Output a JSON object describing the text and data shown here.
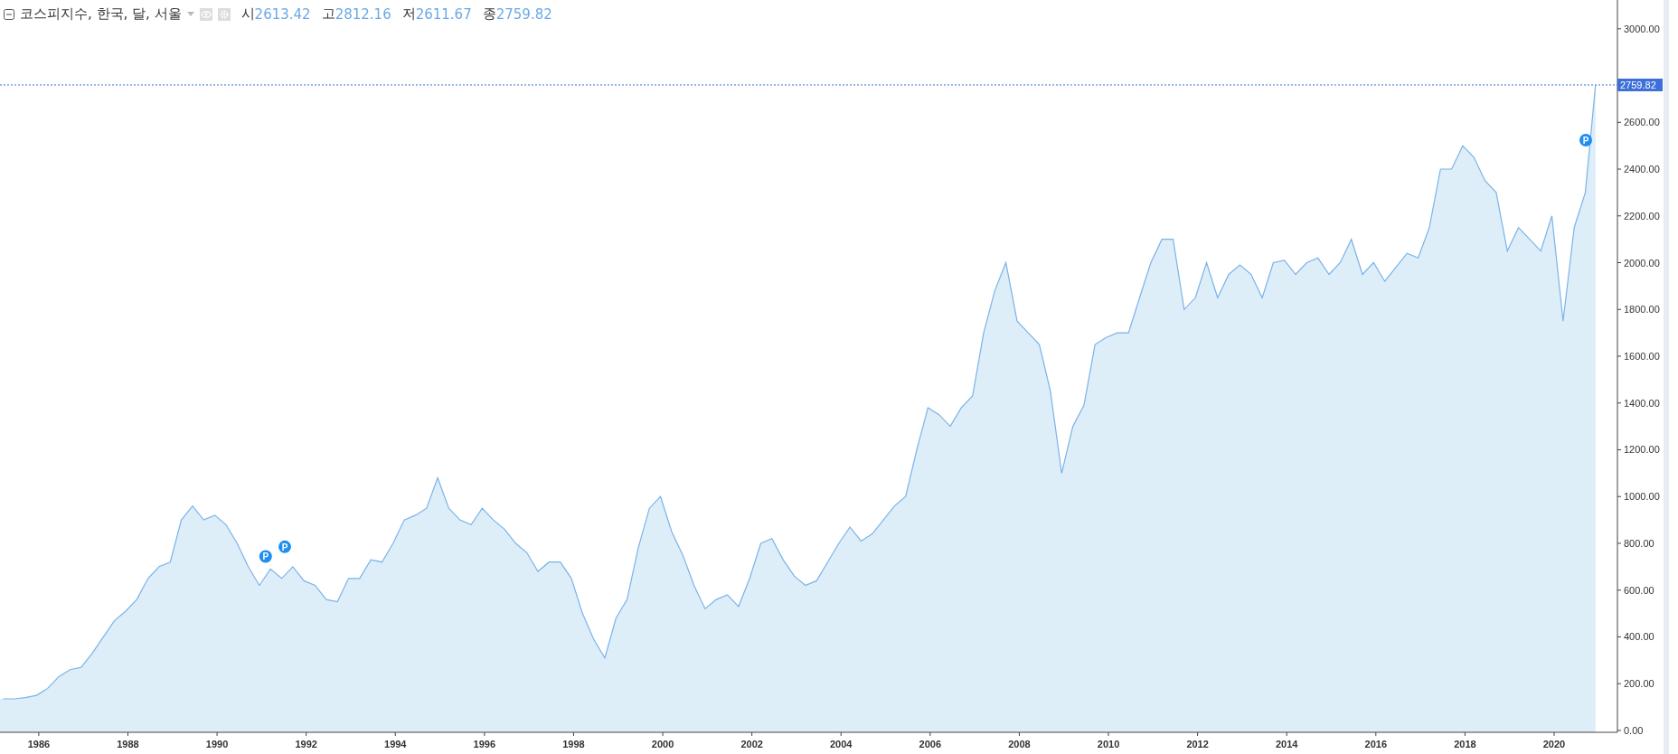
{
  "header": {
    "title": "코스피지수, 한국, 달, 서울",
    "stats": [
      {
        "label": "시",
        "value": "2613.42"
      },
      {
        "label": "고",
        "value": "2812.16"
      },
      {
        "label": "저",
        "value": "2611.67"
      },
      {
        "label": "종",
        "value": "2759.82"
      }
    ]
  },
  "chart_data": {
    "type": "area",
    "xlim": [
      1985.13,
      2021.42
    ],
    "ylim": [
      -8,
      3123
    ],
    "xticks": [
      {
        "value": 1986,
        "label": "1986"
      },
      {
        "value": 1988,
        "label": "1988"
      },
      {
        "value": 1990,
        "label": "1990"
      },
      {
        "value": 1992,
        "label": "1992"
      },
      {
        "value": 1994,
        "label": "1994"
      },
      {
        "value": 1996,
        "label": "1996"
      },
      {
        "value": 1998,
        "label": "1998"
      },
      {
        "value": 2000,
        "label": "2000"
      },
      {
        "value": 2002,
        "label": "2002"
      },
      {
        "value": 2004,
        "label": "2004"
      },
      {
        "value": 2006,
        "label": "2006"
      },
      {
        "value": 2008,
        "label": "2008"
      },
      {
        "value": 2010,
        "label": "2010"
      },
      {
        "value": 2012,
        "label": "2012"
      },
      {
        "value": 2014,
        "label": "2014"
      },
      {
        "value": 2016,
        "label": "2016"
      },
      {
        "value": 2018,
        "label": "2018"
      },
      {
        "value": 2020,
        "label": "2020"
      }
    ],
    "yticks": [
      {
        "value": 0,
        "label": "0.00"
      },
      {
        "value": 200,
        "label": "200.00"
      },
      {
        "value": 400,
        "label": "400.00"
      },
      {
        "value": 600,
        "label": "600.00"
      },
      {
        "value": 800,
        "label": "800.00"
      },
      {
        "value": 1000,
        "label": "1000.00"
      },
      {
        "value": 1200,
        "label": "1200.00"
      },
      {
        "value": 1400,
        "label": "1400.00"
      },
      {
        "value": 1600,
        "label": "1600.00"
      },
      {
        "value": 1800,
        "label": "1800.00"
      },
      {
        "value": 2000,
        "label": "2000.00"
      },
      {
        "value": 2200,
        "label": "2200.00"
      },
      {
        "value": 2400,
        "label": "2400.00"
      },
      {
        "value": 2600,
        "label": "2600.00"
      },
      {
        "value": 3000,
        "label": "3000.00"
      }
    ],
    "x": [
      1985.2,
      1985.45,
      1985.7,
      1985.95,
      1986.2,
      1986.45,
      1986.7,
      1986.95,
      1987.2,
      1987.45,
      1987.7,
      1987.95,
      1988.2,
      1988.45,
      1988.7,
      1988.95,
      1989.2,
      1989.45,
      1989.7,
      1989.95,
      1990.2,
      1990.45,
      1990.7,
      1990.95,
      1991.2,
      1991.45,
      1991.7,
      1991.95,
      1992.2,
      1992.45,
      1992.7,
      1992.95,
      1993.2,
      1993.45,
      1993.7,
      1993.95,
      1994.2,
      1994.45,
      1994.7,
      1994.95,
      1995.2,
      1995.45,
      1995.7,
      1995.95,
      1996.2,
      1996.45,
      1996.7,
      1996.95,
      1997.2,
      1997.45,
      1997.7,
      1997.95,
      1998.2,
      1998.45,
      1998.7,
      1998.95,
      1999.2,
      1999.45,
      1999.7,
      1999.95,
      2000.2,
      2000.45,
      2000.7,
      2000.95,
      2001.2,
      2001.45,
      2001.7,
      2001.95,
      2002.2,
      2002.45,
      2002.7,
      2002.95,
      2003.2,
      2003.45,
      2003.7,
      2003.95,
      2004.2,
      2004.45,
      2004.7,
      2004.95,
      2005.2,
      2005.45,
      2005.7,
      2005.95,
      2006.2,
      2006.45,
      2006.7,
      2006.95,
      2007.2,
      2007.45,
      2007.7,
      2007.95,
      2008.2,
      2008.45,
      2008.7,
      2008.95,
      2009.2,
      2009.45,
      2009.7,
      2009.95,
      2010.2,
      2010.45,
      2010.7,
      2010.95,
      2011.2,
      2011.45,
      2011.7,
      2011.95,
      2012.2,
      2012.45,
      2012.7,
      2012.95,
      2013.2,
      2013.45,
      2013.7,
      2013.95,
      2014.2,
      2014.45,
      2014.7,
      2014.95,
      2015.2,
      2015.45,
      2015.7,
      2015.95,
      2016.2,
      2016.45,
      2016.7,
      2016.95,
      2017.2,
      2017.45,
      2017.7,
      2017.95,
      2018.2,
      2018.45,
      2018.7,
      2018.95,
      2019.2,
      2019.45,
      2019.7,
      2019.95,
      2020.2,
      2020.45,
      2020.7,
      2020.93
    ],
    "ref_lines": [
      {
        "axis": "y",
        "value": 2759.82,
        "label": "2759.82"
      }
    ],
    "series": [
      {
        "color": "#7ab3e8",
        "values": [
          135,
          135,
          140,
          150,
          180,
          230,
          260,
          270,
          330,
          400,
          470,
          510,
          560,
          650,
          700,
          720,
          900,
          960,
          900,
          920,
          880,
          800,
          700,
          620,
          690,
          650,
          700,
          640,
          620,
          560,
          550,
          650,
          650,
          730,
          720,
          800,
          900,
          920,
          950,
          1080,
          950,
          900,
          880,
          950,
          900,
          860,
          800,
          760,
          680,
          720,
          720,
          650,
          500,
          390,
          310,
          480,
          560,
          780,
          950,
          1000,
          850,
          750,
          620,
          520,
          560,
          580,
          530,
          650,
          800,
          820,
          730,
          660,
          620,
          640,
          720,
          800,
          870,
          810,
          840,
          900,
          960,
          1000,
          1200,
          1380,
          1350,
          1300,
          1380,
          1430,
          1700,
          1880,
          2000,
          1750,
          1700,
          1650,
          1450,
          1100,
          1300,
          1390,
          1650,
          1680,
          1700,
          1700,
          1850,
          2000,
          2100,
          2100,
          1800,
          1850,
          2000,
          1850,
          1950,
          1990,
          1950,
          1850,
          2000,
          2010,
          1950,
          2000,
          2020,
          1950,
          2000,
          2100,
          1950,
          2000,
          1920,
          1980,
          2040,
          2020,
          2150,
          2400,
          2400,
          2500,
          2450,
          2350,
          2300,
          2050,
          2150,
          2100,
          2050,
          2200,
          1750,
          2150,
          2300,
          2760
        ]
      }
    ],
    "annotations": [
      {
        "x": 1991.09,
        "y": 744,
        "text": "P"
      },
      {
        "x": 1991.52,
        "y": 785,
        "text": "P"
      },
      {
        "x": 2020.71,
        "y": 2524,
        "text": "P"
      }
    ]
  }
}
